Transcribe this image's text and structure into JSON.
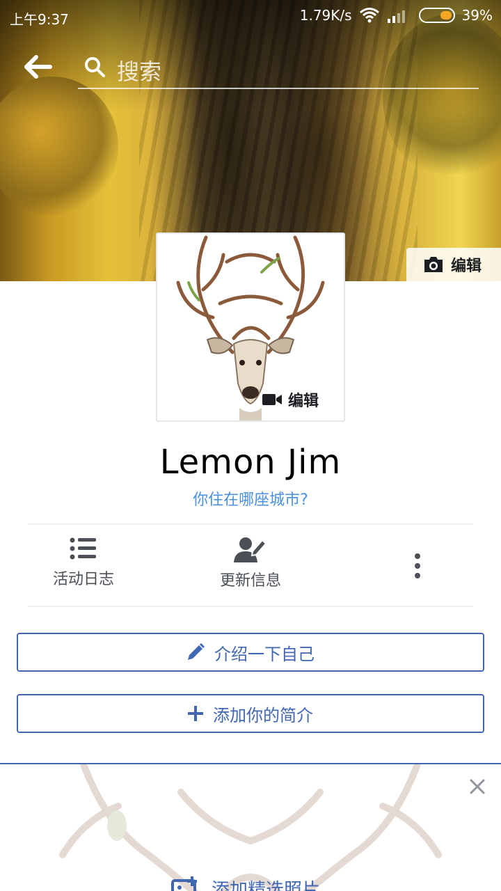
{
  "status_bar": {
    "time": "上午9:37",
    "network_speed": "1.79K/s",
    "battery_percent": "39%",
    "battery_level": 0.39,
    "battery_color": "#f5a623"
  },
  "search": {
    "placeholder": "搜索",
    "back_icon": "arrow-left-icon",
    "search_icon": "magnifier-icon"
  },
  "cover": {
    "edit_label": "编辑",
    "edit_icon": "camera-icon"
  },
  "profile": {
    "edit_label": "编辑",
    "edit_icon": "video-camera-icon",
    "name": "Lemon Jim",
    "city_prompt": "你住在哪座城市?"
  },
  "actions": [
    {
      "label": "活动日志",
      "icon": "list-icon"
    },
    {
      "label": "更新信息",
      "icon": "edit-profile-icon"
    },
    {
      "label": "",
      "icon": "more-vertical-icon"
    }
  ],
  "buttons": {
    "intro_label": "介绍一下自己",
    "intro_icon": "pencil-icon",
    "bio_label": "添加你的简介",
    "bio_icon": "plus-icon"
  },
  "featured": {
    "add_label": "添加精选照片",
    "add_icon": "add-photo-icon",
    "close_icon": "close-icon"
  },
  "colors": {
    "accent": "#4267b2",
    "link": "#4a90e2",
    "text_secondary": "#4b4f56"
  }
}
